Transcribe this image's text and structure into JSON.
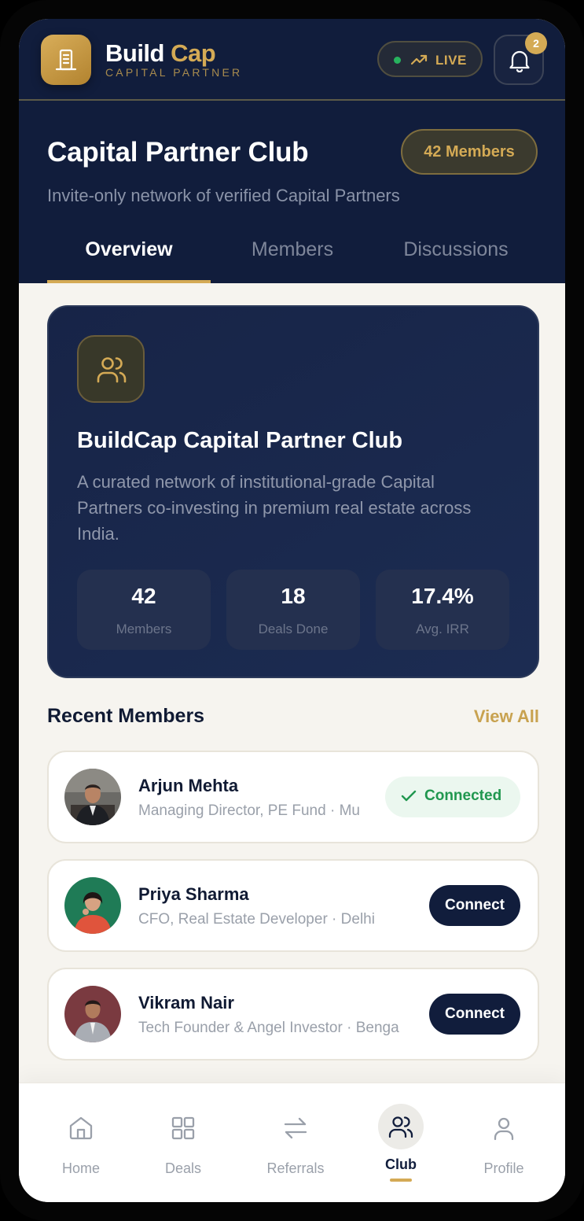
{
  "app": {
    "brand_part1": "Build",
    "brand_part2": "Cap",
    "brand_subtitle": "CAPITAL PARTNER",
    "live_label": "LIVE",
    "notification_count": "2"
  },
  "club": {
    "title": "Capital Partner Club",
    "members_badge": "42 Members",
    "subtitle": "Invite-only network of verified Capital Partners"
  },
  "tabs": [
    {
      "label": "Overview",
      "active": true
    },
    {
      "label": "Members",
      "active": false
    },
    {
      "label": "Discussions",
      "active": false
    }
  ],
  "hero": {
    "icon": "users-icon",
    "title": "BuildCap Capital Partner Club",
    "description": "A curated network of institutional-grade Capital Partners co-investing in premium real estate across India.",
    "stats": [
      {
        "value": "42",
        "label": "Members"
      },
      {
        "value": "18",
        "label": "Deals Done"
      },
      {
        "value": "17.4%",
        "label": "Avg. IRR"
      }
    ]
  },
  "recent_members": {
    "title": "Recent Members",
    "view_all": "View All",
    "items": [
      {
        "name": "Arjun Mehta",
        "role": "Managing Director, PE Fund · Mu",
        "status": "connected",
        "action_label": "Connected"
      },
      {
        "name": "Priya Sharma",
        "role": "CFO, Real Estate Developer · Delhi",
        "status": "not_connected",
        "action_label": "Connect"
      },
      {
        "name": "Vikram Nair",
        "role": "Tech Founder & Angel Investor · Benga",
        "status": "not_connected",
        "action_label": "Connect"
      }
    ]
  },
  "bottom_nav": [
    {
      "label": "Home",
      "icon": "home-icon",
      "active": false
    },
    {
      "label": "Deals",
      "icon": "grid-icon",
      "active": false
    },
    {
      "label": "Referrals",
      "icon": "swap-arrows-icon",
      "active": false
    },
    {
      "label": "Club",
      "icon": "users-icon",
      "active": true
    },
    {
      "label": "Profile",
      "icon": "user-icon",
      "active": false
    }
  ],
  "colors": {
    "navy": "#111d3c",
    "gold": "#d4aa55",
    "background": "#f6f4ef",
    "success": "#20974f"
  }
}
